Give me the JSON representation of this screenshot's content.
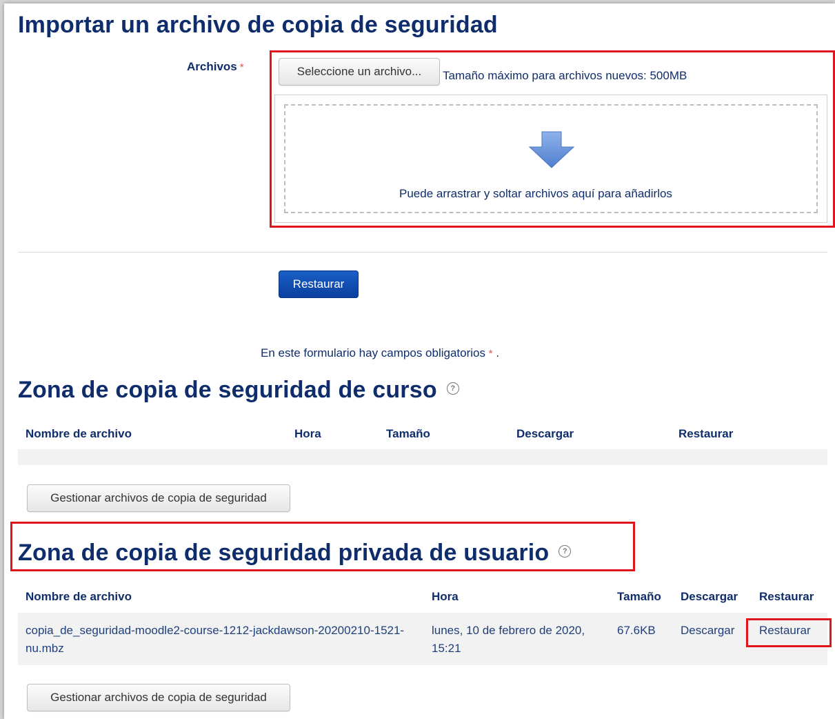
{
  "import_section": {
    "title": "Importar un archivo de copia de seguridad",
    "files_label": "Archivos",
    "required_mark": "*",
    "choose_file_button": "Seleccione un archivo...",
    "max_size_text": "Tamaño máximo para archivos nuevos: 500MB",
    "dropzone_text": "Puede arrastrar y soltar archivos aquí para añadirlos",
    "restore_button": "Restaurar",
    "required_note": "En este formulario hay campos obligatorios",
    "required_note_suffix": "."
  },
  "course_zone": {
    "title": "Zona de copia de seguridad de curso",
    "help_icon": "question-circle-icon",
    "columns": [
      "Nombre de archivo",
      "Hora",
      "Tamaño",
      "Descargar",
      "Restaurar"
    ],
    "manage_button": "Gestionar archivos de copia de seguridad"
  },
  "user_zone": {
    "title": "Zona de copia de seguridad privada de usuario",
    "help_icon": "question-circle-icon",
    "columns": [
      "Nombre de archivo",
      "Hora",
      "Tamaño",
      "Descargar",
      "Restaurar"
    ],
    "rows": [
      {
        "filename": "copia_de_seguridad-moodle2-course-1212-jackdawson-20200210-1521-nu.mbz",
        "time": "lunes, 10 de febrero de 2020, 15:21",
        "size": "67.6KB",
        "download": "Descargar",
        "restore": "Restaurar"
      }
    ],
    "manage_button": "Gestionar archivos de copia de seguridad"
  },
  "colors": {
    "heading": "#0f2d6b",
    "link": "#1a5ab8",
    "primary_button": "#0a3f9e",
    "highlight_box": "#e2141b",
    "required_star": "#d9534f"
  }
}
